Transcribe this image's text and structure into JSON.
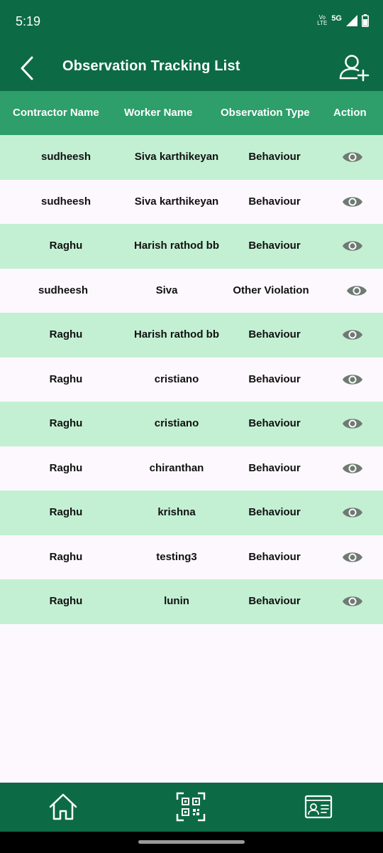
{
  "status": {
    "time": "5:19",
    "volte_top": "Vo",
    "volte_bottom": "LTE",
    "network": "5G"
  },
  "app_bar": {
    "title": "Observation Tracking List"
  },
  "table": {
    "headers": [
      "Contractor Name",
      "Worker Name",
      "Observation Type",
      "Action"
    ],
    "rows": [
      {
        "contractor": "sudheesh",
        "worker": "Siva karthikeyan",
        "type": "Behaviour"
      },
      {
        "contractor": "sudheesh",
        "worker": "Siva karthikeyan",
        "type": "Behaviour"
      },
      {
        "contractor": "Raghu",
        "worker": "Harish rathod bb",
        "type": "Behaviour"
      },
      {
        "contractor": "sudheesh",
        "worker": "Siva",
        "type": "Other Violation"
      },
      {
        "contractor": "Raghu",
        "worker": "Harish rathod bb",
        "type": "Behaviour"
      },
      {
        "contractor": "Raghu",
        "worker": "cristiano",
        "type": "Behaviour"
      },
      {
        "contractor": "Raghu",
        "worker": "cristiano",
        "type": "Behaviour"
      },
      {
        "contractor": "Raghu",
        "worker": "chiranthan",
        "type": "Behaviour"
      },
      {
        "contractor": "Raghu",
        "worker": "krishna",
        "type": "Behaviour"
      },
      {
        "contractor": "Raghu",
        "worker": "testing3",
        "type": "Behaviour"
      },
      {
        "contractor": "Raghu",
        "worker": "lunin",
        "type": "Behaviour"
      }
    ]
  },
  "icons": {
    "back": "chevron-left-icon",
    "add_user": "add-user-icon",
    "view": "eye-icon",
    "nav": [
      "home-icon",
      "qr-scan-icon",
      "id-card-icon"
    ]
  },
  "colors": {
    "primary": "#0c6b45",
    "header": "#2e9e6a",
    "row_alt": "#c3f0d3",
    "eye": "#6f7a73"
  }
}
